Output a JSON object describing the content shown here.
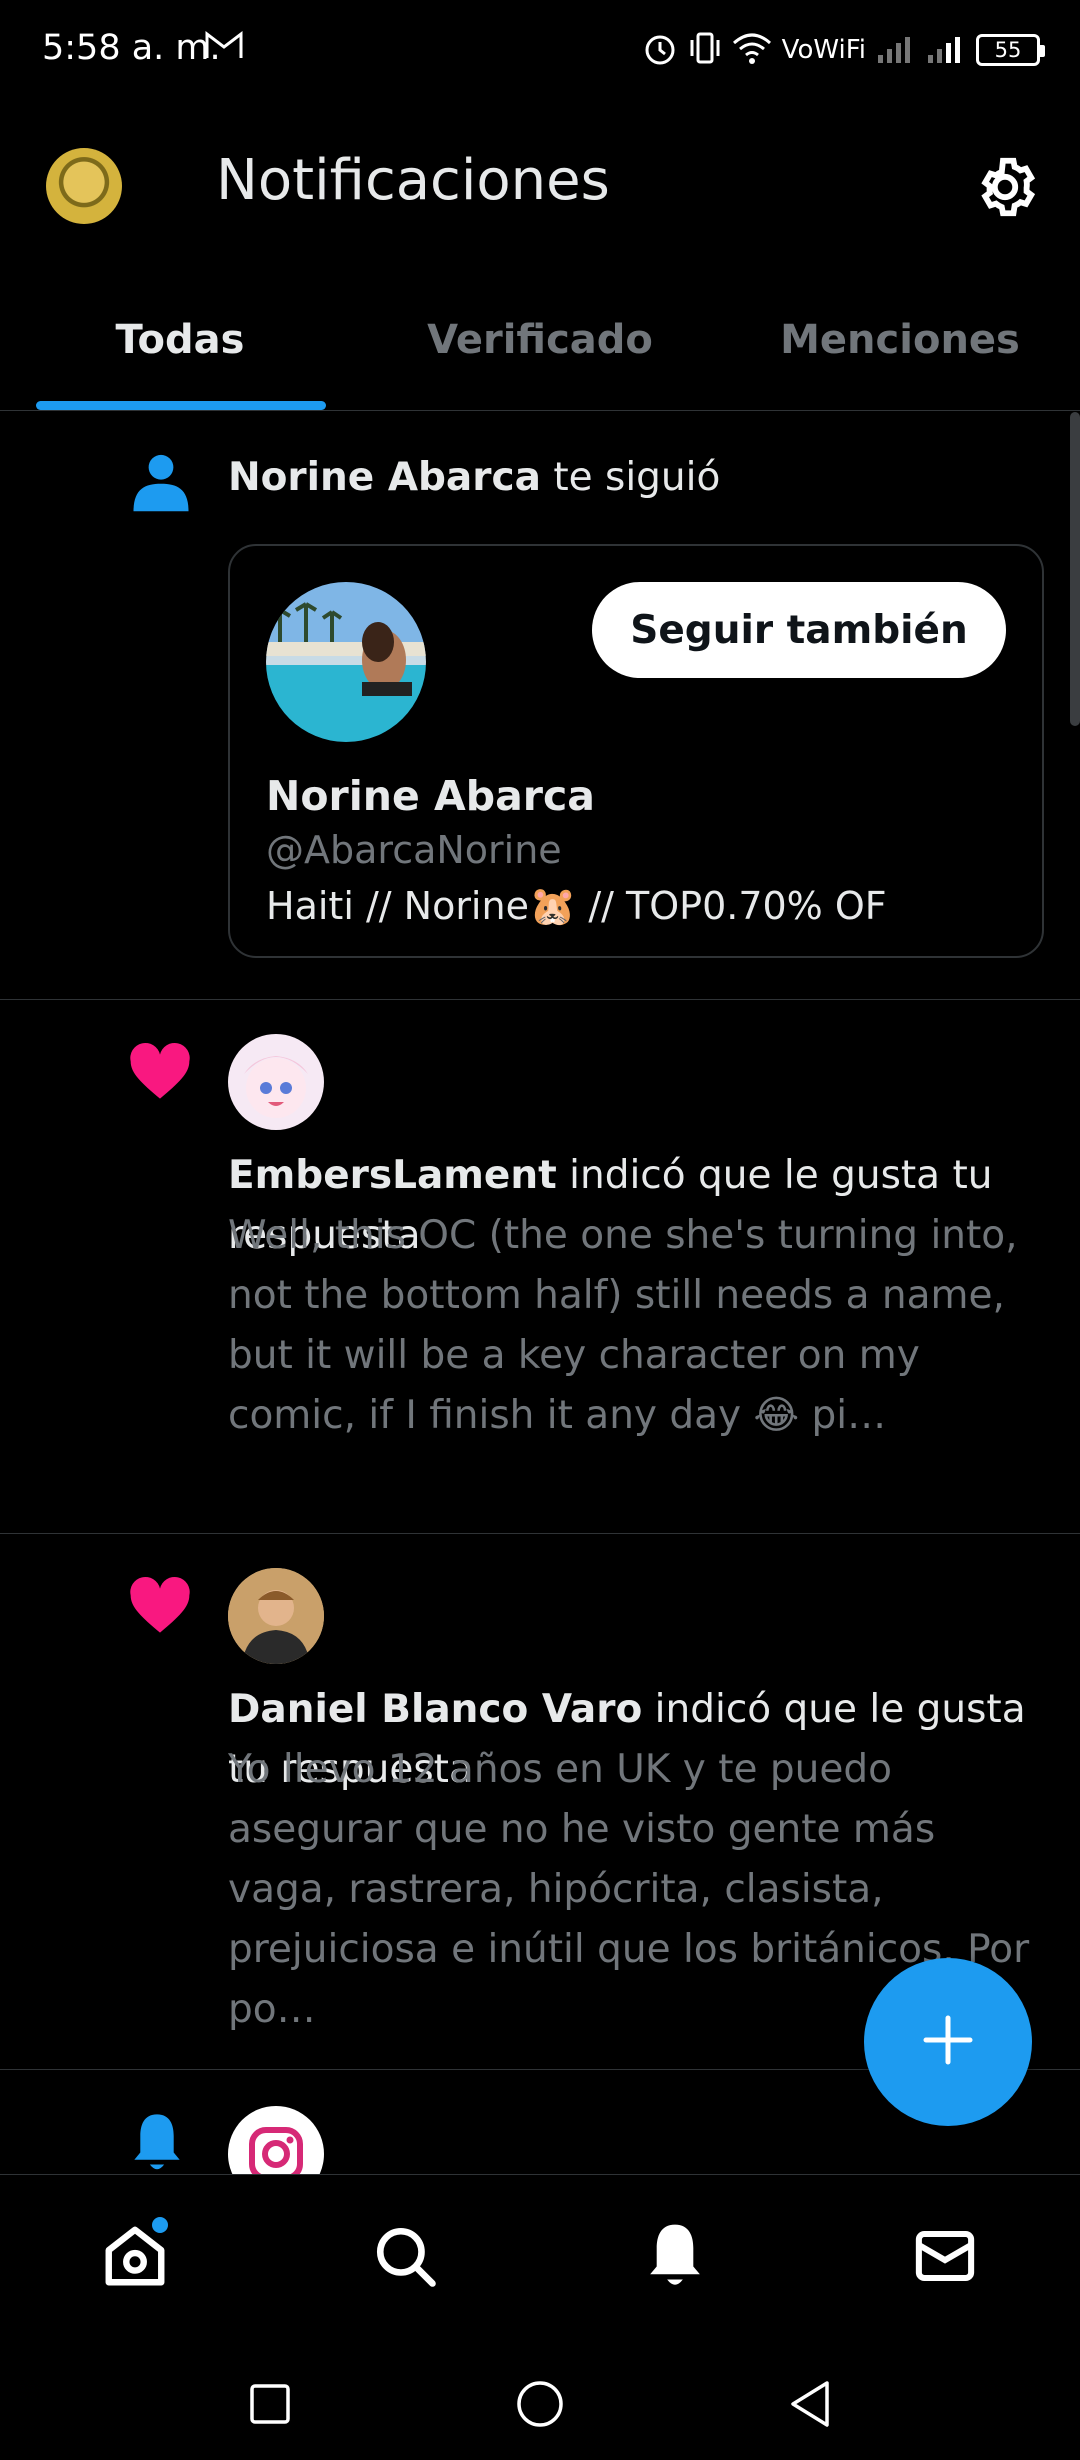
{
  "status_bar": {
    "time": "5:58 a. m.",
    "network_label": "VoWiFi",
    "battery": "55"
  },
  "header": {
    "title": "Notificaciones"
  },
  "tabs": [
    {
      "label": "Todas",
      "active": true
    },
    {
      "label": "Verificado",
      "active": false
    },
    {
      "label": "Menciones",
      "active": false
    }
  ],
  "notifications": [
    {
      "type": "follow",
      "icon": "person-icon",
      "actor": "Norine Abarca",
      "action": " te siguió",
      "card": {
        "name": "Norine Abarca",
        "handle": "@AbarcaNorine",
        "bio": "Haiti // Norine🐹 // TOP0.70% OF",
        "button_label": "Seguir también"
      }
    },
    {
      "type": "like",
      "icon": "heart-icon",
      "actor": "EmbersLament",
      "action": " indicó que le gusta tu respuesta",
      "body": "Well, this OC (the one she's turning into, not the bottom half) still needs a name, but it will be a key character on my comic, if I finish it any day 😂 pi…"
    },
    {
      "type": "like",
      "icon": "heart-icon",
      "actor": "Daniel Blanco Varo",
      "action": " indicó que le gusta tu respuesta",
      "body": "Yo llevo 12 años en UK y te puedo asegurar que no he visto gente más vaga, rastrera, hipócrita, clasista, prejuiciosa e inútil que los británicos. Por po…"
    },
    {
      "type": "alert",
      "icon": "bell-icon"
    }
  ],
  "colors": {
    "accent": "#1d9bf0",
    "like": "#f91880",
    "background": "#000000",
    "muted": "#71767b",
    "divider": "#2f3336"
  },
  "bottom_nav": [
    "home-icon",
    "search-icon",
    "notifications-icon",
    "messages-icon"
  ],
  "system_nav": [
    "recents-button",
    "home-button",
    "back-button"
  ]
}
